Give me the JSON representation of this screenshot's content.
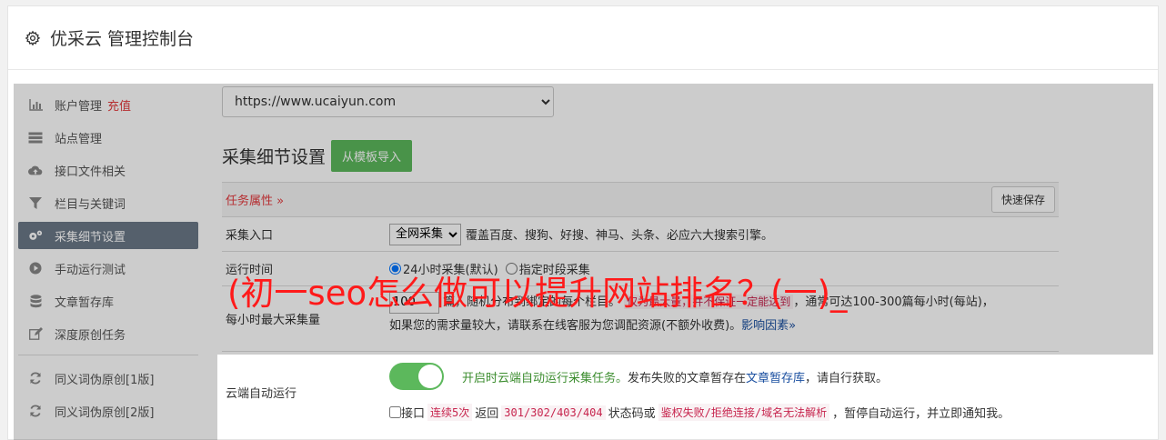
{
  "header": {
    "title": "优采云 管理控制台",
    "icon": "gear-icon"
  },
  "sidebar": {
    "items": [
      {
        "label": "账户管理",
        "badge": "充值",
        "icon": "bar-chart-icon"
      },
      {
        "label": "站点管理",
        "icon": "server-icon"
      },
      {
        "label": "接口文件相关",
        "icon": "cloud-upload-icon"
      },
      {
        "label": "栏目与关键词",
        "icon": "filter-icon"
      },
      {
        "label": "采集细节设置",
        "icon": "cogs-icon",
        "active": true
      },
      {
        "label": "手动运行测试",
        "icon": "play-circle-icon"
      },
      {
        "label": "文章暂存库",
        "icon": "database-icon"
      },
      {
        "label": "深度原创任务",
        "icon": "edit-icon"
      }
    ],
    "items2": [
      {
        "label": "同义词伪原创[1版]",
        "icon": "refresh-icon"
      },
      {
        "label": "同义词伪原创[2版]",
        "icon": "refresh-icon"
      }
    ]
  },
  "main": {
    "site_select": "https://www.ucaiyun.com",
    "section_title": "采集细节设置",
    "import_button": "从模板导入",
    "task_attr": "任务属性 »",
    "quick_save": "快速保存",
    "entry_label": "采集入口",
    "entry_select": "全网采集",
    "entry_desc": "覆盖百度、搜狗、好搜、神马、头条、必应六大搜索引擎。",
    "run_time_label": "运行时间",
    "run_opt1": "24小时采集(默认)",
    "run_opt2": "指定时段采集",
    "max_label": "每小时最大采集量",
    "max_value": "100",
    "max_desc1": "篇，随机分布到绑定的每个栏目。",
    "max_code": "仅为最大量，并不保证一定能达到",
    "max_desc2": "，通常可达100-300篇每小时(每站)，",
    "max_desc3": "如果您的需求量较大，请联系在线客服为您调配资源(不额外收费)。",
    "max_link": "影响因素»",
    "cloud_label": "云端自动运行",
    "cloud_green": "开启时云端自动运行采集任务。",
    "cloud_desc": "发布失败的文章暂存在",
    "cloud_link": "文章暂存库",
    "cloud_desc2": "，请自行获取。",
    "iface_prefix": "接口",
    "iface_code1": "连续5次",
    "iface_mid1": "返回",
    "iface_code2": "301/302/403/404",
    "iface_mid2": "状态码或",
    "iface_code3": "鉴权失败/拒绝连接/域名无法解析",
    "iface_suffix": "，暂停自动运行，并立即通知我。"
  },
  "overlay": {
    "headline": "(初一seo怎么做可以提升网站排名？(一)_"
  }
}
